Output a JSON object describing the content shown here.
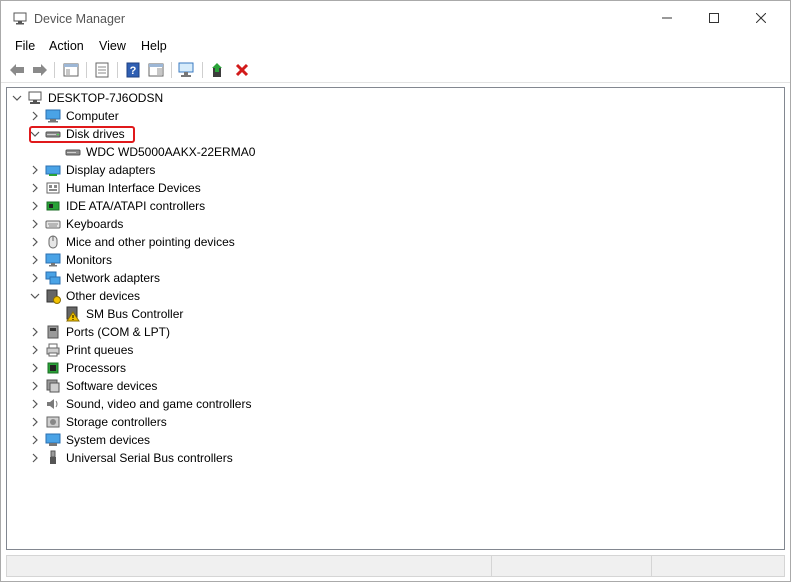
{
  "window": {
    "title": "Device Manager",
    "controls": {
      "minimize": "minimize",
      "maximize": "maximize",
      "close": "close"
    }
  },
  "menu": [
    "File",
    "Action",
    "View",
    "Help"
  ],
  "toolbar": {
    "buttons": [
      "back-icon",
      "forward-icon",
      "show-hide-console-tree-icon",
      "properties-icon",
      "help-icon",
      "action-pane-icon",
      "scan-hardware-changes-icon",
      "update-driver-icon",
      "uninstall-device-icon"
    ]
  },
  "tree": {
    "root": "DESKTOP-7J6ODSN",
    "items": [
      {
        "label": "Computer",
        "icon": "computer-icon",
        "expanded": false
      },
      {
        "label": "Disk drives",
        "icon": "disk-drive-icon",
        "expanded": true,
        "children": [
          "WDC WD5000AAKX-22ERMA0"
        ]
      },
      {
        "label": "Display adapters",
        "icon": "display-adapter-icon",
        "expanded": false
      },
      {
        "label": "Human Interface Devices",
        "icon": "hid-icon",
        "expanded": false
      },
      {
        "label": "IDE ATA/ATAPI controllers",
        "icon": "ide-controller-icon",
        "expanded": false
      },
      {
        "label": "Keyboards",
        "icon": "keyboard-icon",
        "expanded": false
      },
      {
        "label": "Mice and other pointing devices",
        "icon": "mouse-icon",
        "expanded": false
      },
      {
        "label": "Monitors",
        "icon": "monitor-icon",
        "expanded": false
      },
      {
        "label": "Network adapters",
        "icon": "network-adapter-icon",
        "expanded": false
      },
      {
        "label": "Other devices",
        "icon": "other-devices-icon",
        "expanded": true,
        "children": [
          "SM Bus Controller"
        ]
      },
      {
        "label": "Ports (COM & LPT)",
        "icon": "port-icon",
        "expanded": false
      },
      {
        "label": "Print queues",
        "icon": "printer-icon",
        "expanded": false
      },
      {
        "label": "Processors",
        "icon": "processor-icon",
        "expanded": false
      },
      {
        "label": "Software devices",
        "icon": "software-device-icon",
        "expanded": false
      },
      {
        "label": "Sound, video and game controllers",
        "icon": "sound-icon",
        "expanded": false
      },
      {
        "label": "Storage controllers",
        "icon": "storage-controller-icon",
        "expanded": false
      },
      {
        "label": "System devices",
        "icon": "system-device-icon",
        "expanded": false
      },
      {
        "label": "Universal Serial Bus controllers",
        "icon": "usb-icon",
        "expanded": false
      }
    ]
  },
  "highlight_color": "#e0191b"
}
